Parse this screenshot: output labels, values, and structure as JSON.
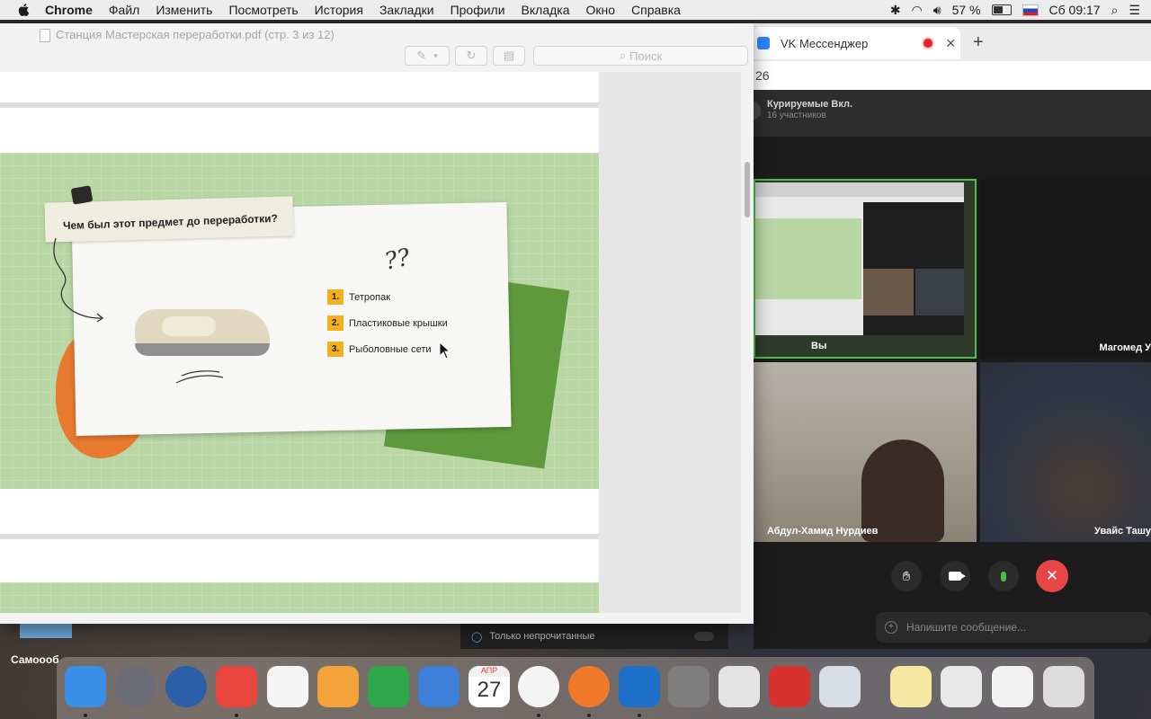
{
  "menubar": {
    "app": "Chrome",
    "items": [
      "Файл",
      "Изменить",
      "Посмотреть",
      "История",
      "Закладки",
      "Профили",
      "Вкладка",
      "Окно",
      "Справка"
    ],
    "battery": "57 %",
    "datetime": "Сб 09:17"
  },
  "preview": {
    "title": "Станция Мастерская переработки.pdf (стр. 3 из 12)",
    "search_placeholder": "Поиск",
    "slide": {
      "question": "Чем был этот предмет до переработки?",
      "qmarks": "??",
      "options": [
        {
          "num": "1.",
          "text": "Тетропак"
        },
        {
          "num": "2.",
          "text": "Пластиковые крышки"
        },
        {
          "num": "3.",
          "text": "Рыболовные сети"
        }
      ]
    }
  },
  "vk": {
    "tab_title": "VK Мессенджер",
    "new_tab": "+",
    "addr_fragment": "26",
    "chat_name": "Курируемые Вкл.",
    "chat_members": "16 участников",
    "tiles": [
      {
        "name": "Вы"
      },
      {
        "name": "Магомед У"
      },
      {
        "name": "Абдул-Хамид Нурдиев"
      },
      {
        "name": "Увайс Ташу"
      }
    ],
    "input_placeholder": "Напишите сообщение...",
    "unread_label": "Только непрочитанные"
  },
  "desktop": {
    "label": "Самоооб"
  },
  "dock": {
    "calendar_month": "АПР",
    "calendar_day": "27",
    "items": [
      "finder-icon",
      "launchpad-icon",
      "quicktime-icon",
      "anydesk-icon",
      "photos-icon",
      "pages-icon",
      "numbers-icon",
      "keynote-icon",
      "calendar-icon",
      "chrome-icon",
      "firefox-icon",
      "openoffice-icon",
      "system-preferences-icon",
      "hp-utility-icon",
      "flashcards-icon",
      "preview-icon",
      "notes-icon",
      "screenshots-stack-icon",
      "documents-stack-icon",
      "trash-icon"
    ]
  }
}
